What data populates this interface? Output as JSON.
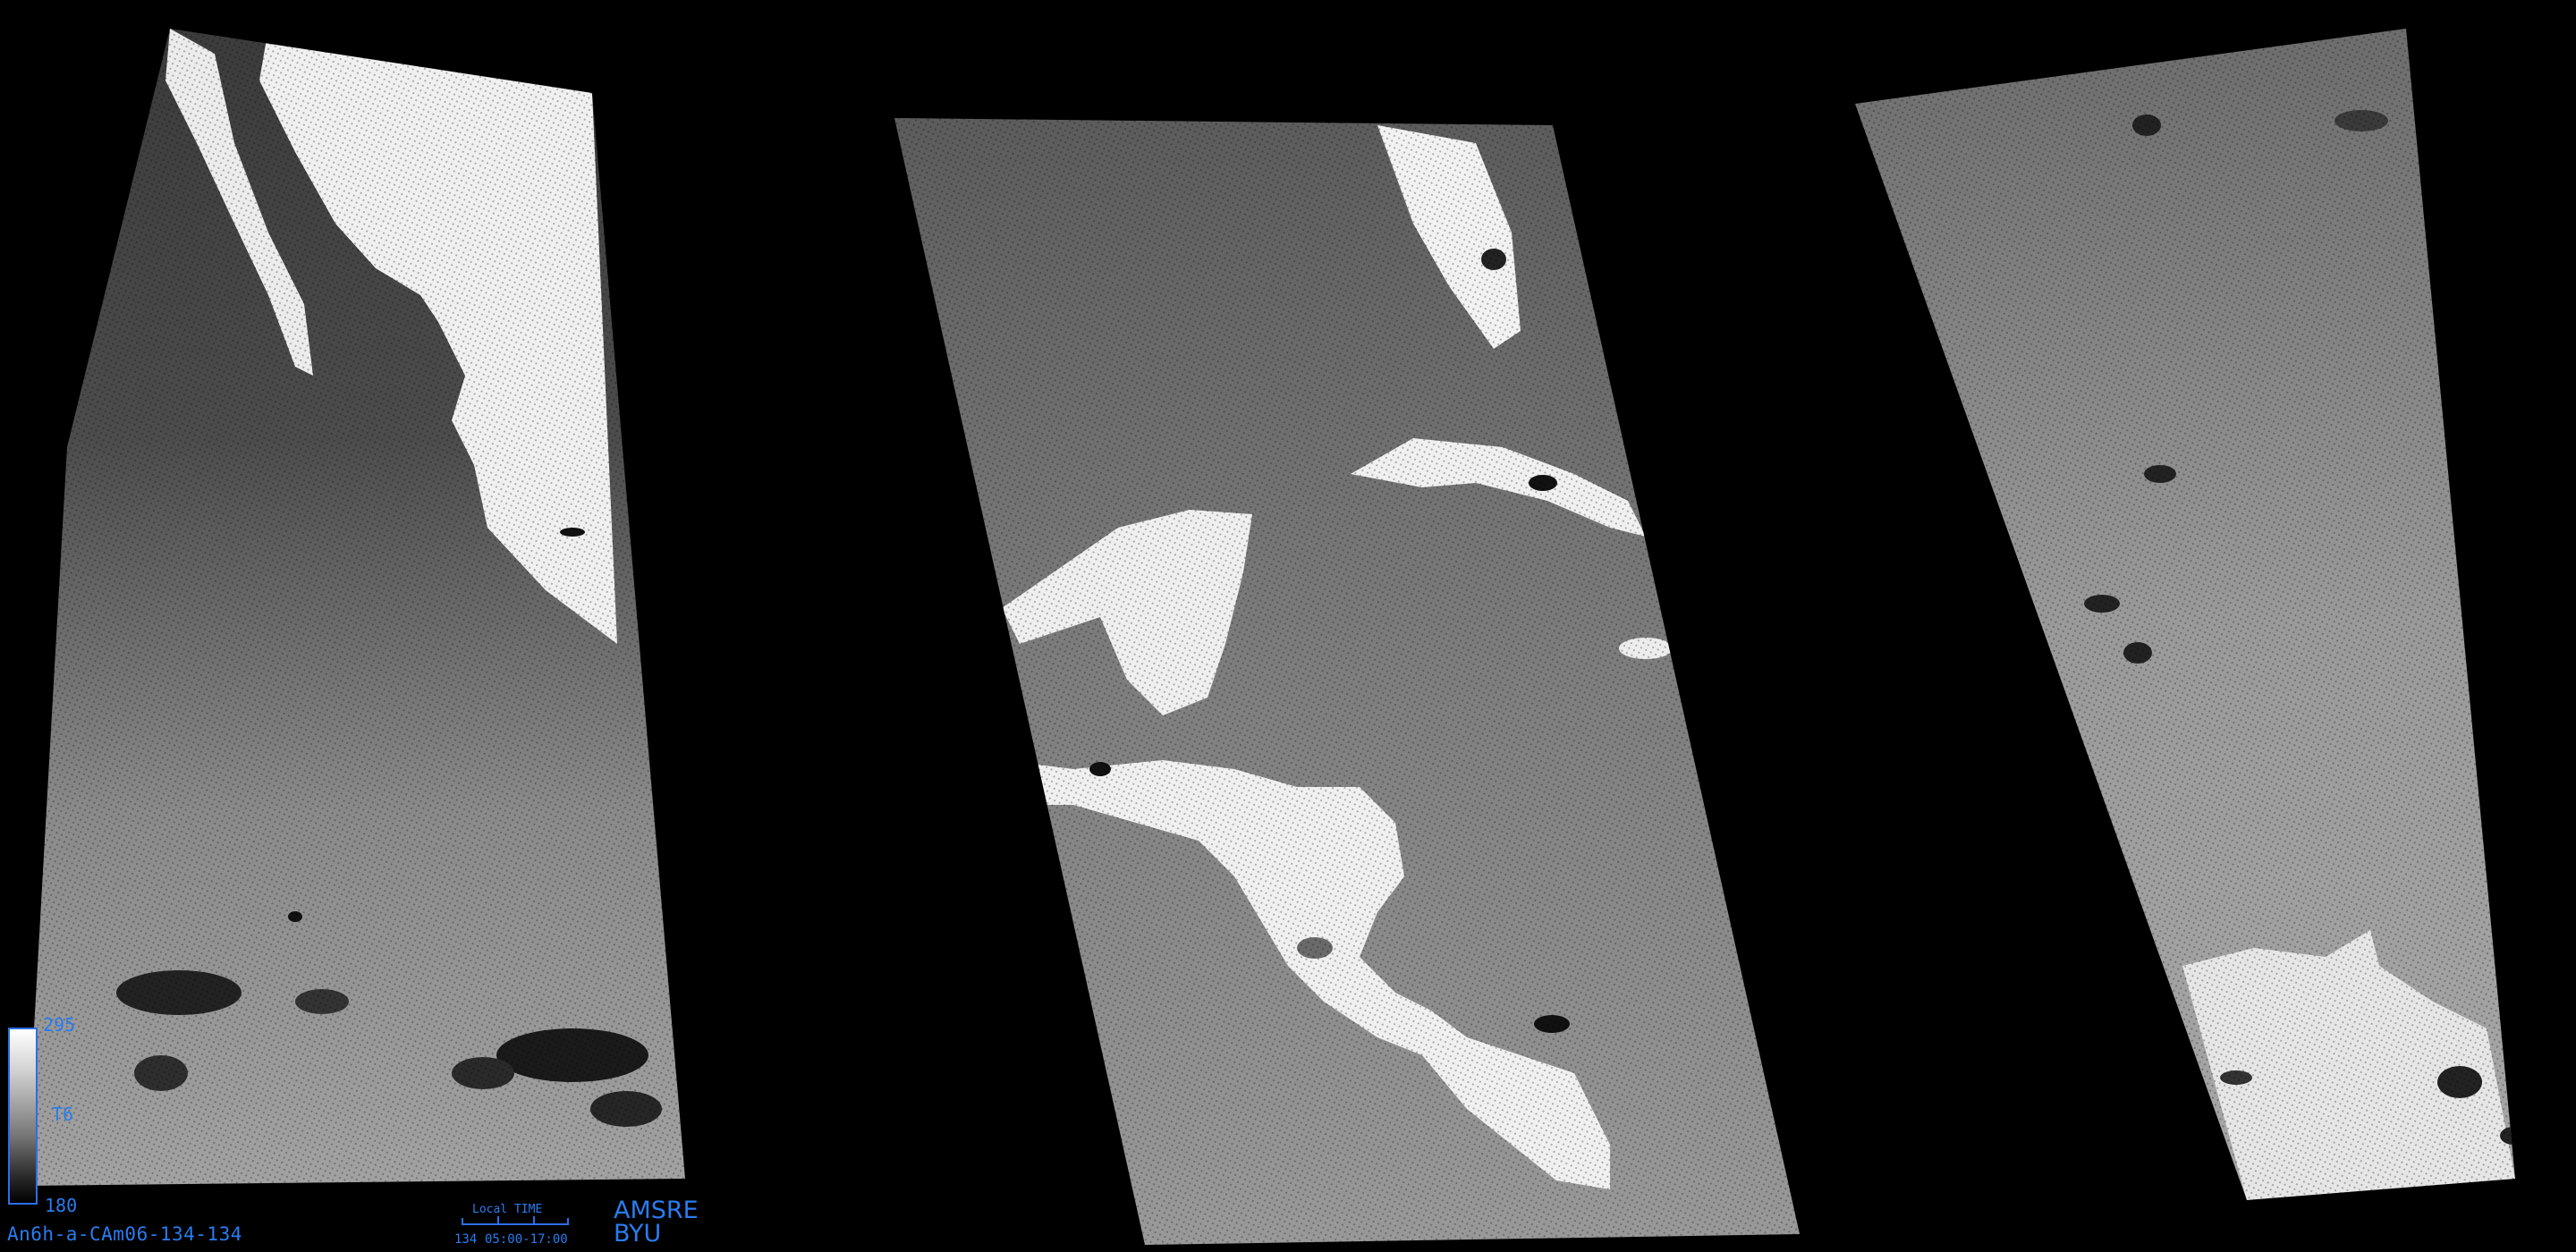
{
  "image_id": "An6h-a-CAm06-134-134",
  "colorbar": {
    "max_label": "295",
    "mid_label": "T6",
    "min_label": "180"
  },
  "timescale": {
    "caption": "Local TIME",
    "day": "134",
    "range": "05:00-17:00"
  },
  "sensor": "AMSRE",
  "organization": "BYU",
  "colors": {
    "background": "#000000",
    "label_blue": "#2a7cf0"
  }
}
